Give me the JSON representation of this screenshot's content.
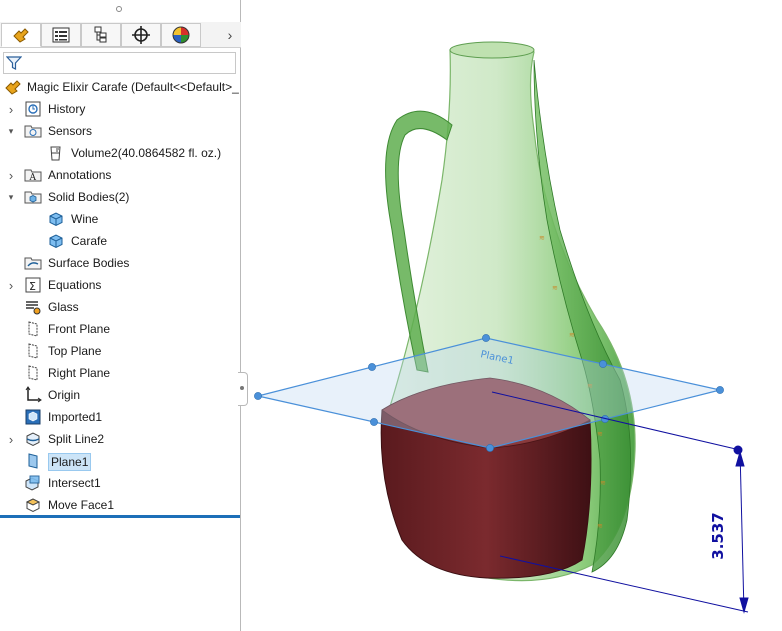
{
  "tabs": [
    {
      "name": "feature-manager",
      "icon": "feature-manager-icon",
      "active": true
    },
    {
      "name": "property-manager",
      "icon": "property-manager-icon",
      "active": false
    },
    {
      "name": "configuration-manager",
      "icon": "configuration-manager-icon",
      "active": false
    },
    {
      "name": "dimxpert-manager",
      "icon": "dimxpert-icon",
      "active": false
    },
    {
      "name": "display-manager",
      "icon": "display-manager-icon",
      "active": false
    }
  ],
  "root": {
    "label": "Magic Elixir Carafe  (Default<<Default>_"
  },
  "tree": [
    {
      "label": "History",
      "icon": "history-icon",
      "expander": "collapsed",
      "indent": 0
    },
    {
      "label": "Sensors",
      "icon": "sensors-folder-icon",
      "expander": "expanded",
      "indent": 0
    },
    {
      "label": "Volume2(40.0864582 fl. oz.)",
      "icon": "volume-sensor-icon",
      "expander": "none",
      "indent": 1
    },
    {
      "label": "Annotations",
      "icon": "annotations-icon",
      "expander": "collapsed",
      "indent": 0
    },
    {
      "label": "Solid Bodies(2)",
      "icon": "solid-bodies-folder-icon",
      "expander": "expanded",
      "indent": 0
    },
    {
      "label": "Wine",
      "icon": "solid-body-icon",
      "expander": "none",
      "indent": 1
    },
    {
      "label": "Carafe",
      "icon": "solid-body-icon",
      "expander": "none",
      "indent": 1
    },
    {
      "label": "Surface Bodies",
      "icon": "surface-bodies-folder-icon",
      "expander": "none",
      "indent": 0
    },
    {
      "label": "Equations",
      "icon": "equations-icon",
      "expander": "collapsed",
      "indent": 0
    },
    {
      "label": "Glass",
      "icon": "material-icon",
      "expander": "none",
      "indent": 0
    },
    {
      "label": "Front Plane",
      "icon": "plane-icon",
      "expander": "none",
      "indent": 0
    },
    {
      "label": "Top Plane",
      "icon": "plane-icon",
      "expander": "none",
      "indent": 0
    },
    {
      "label": "Right Plane",
      "icon": "plane-icon",
      "expander": "none",
      "indent": 0
    },
    {
      "label": "Origin",
      "icon": "origin-icon",
      "expander": "none",
      "indent": 0
    },
    {
      "label": "Imported1",
      "icon": "imported-feature-icon",
      "expander": "none",
      "indent": 0
    },
    {
      "label": "Split Line2",
      "icon": "split-line-icon",
      "expander": "collapsed",
      "indent": 0
    },
    {
      "label": "Plane1",
      "icon": "plane-selected-icon",
      "expander": "none",
      "indent": 0,
      "selected": true
    },
    {
      "label": "Intersect1",
      "icon": "intersect-icon",
      "expander": "none",
      "indent": 0
    },
    {
      "label": "Move Face1",
      "icon": "move-face-icon",
      "expander": "none",
      "indent": 0
    }
  ],
  "viewport": {
    "dimension": "3.537",
    "plane_label": "Plane1",
    "colors": {
      "glass": "#5fae4f",
      "wine": "#6b1f24",
      "plane": "#4a90d9",
      "dimension": "#1010a0"
    }
  }
}
